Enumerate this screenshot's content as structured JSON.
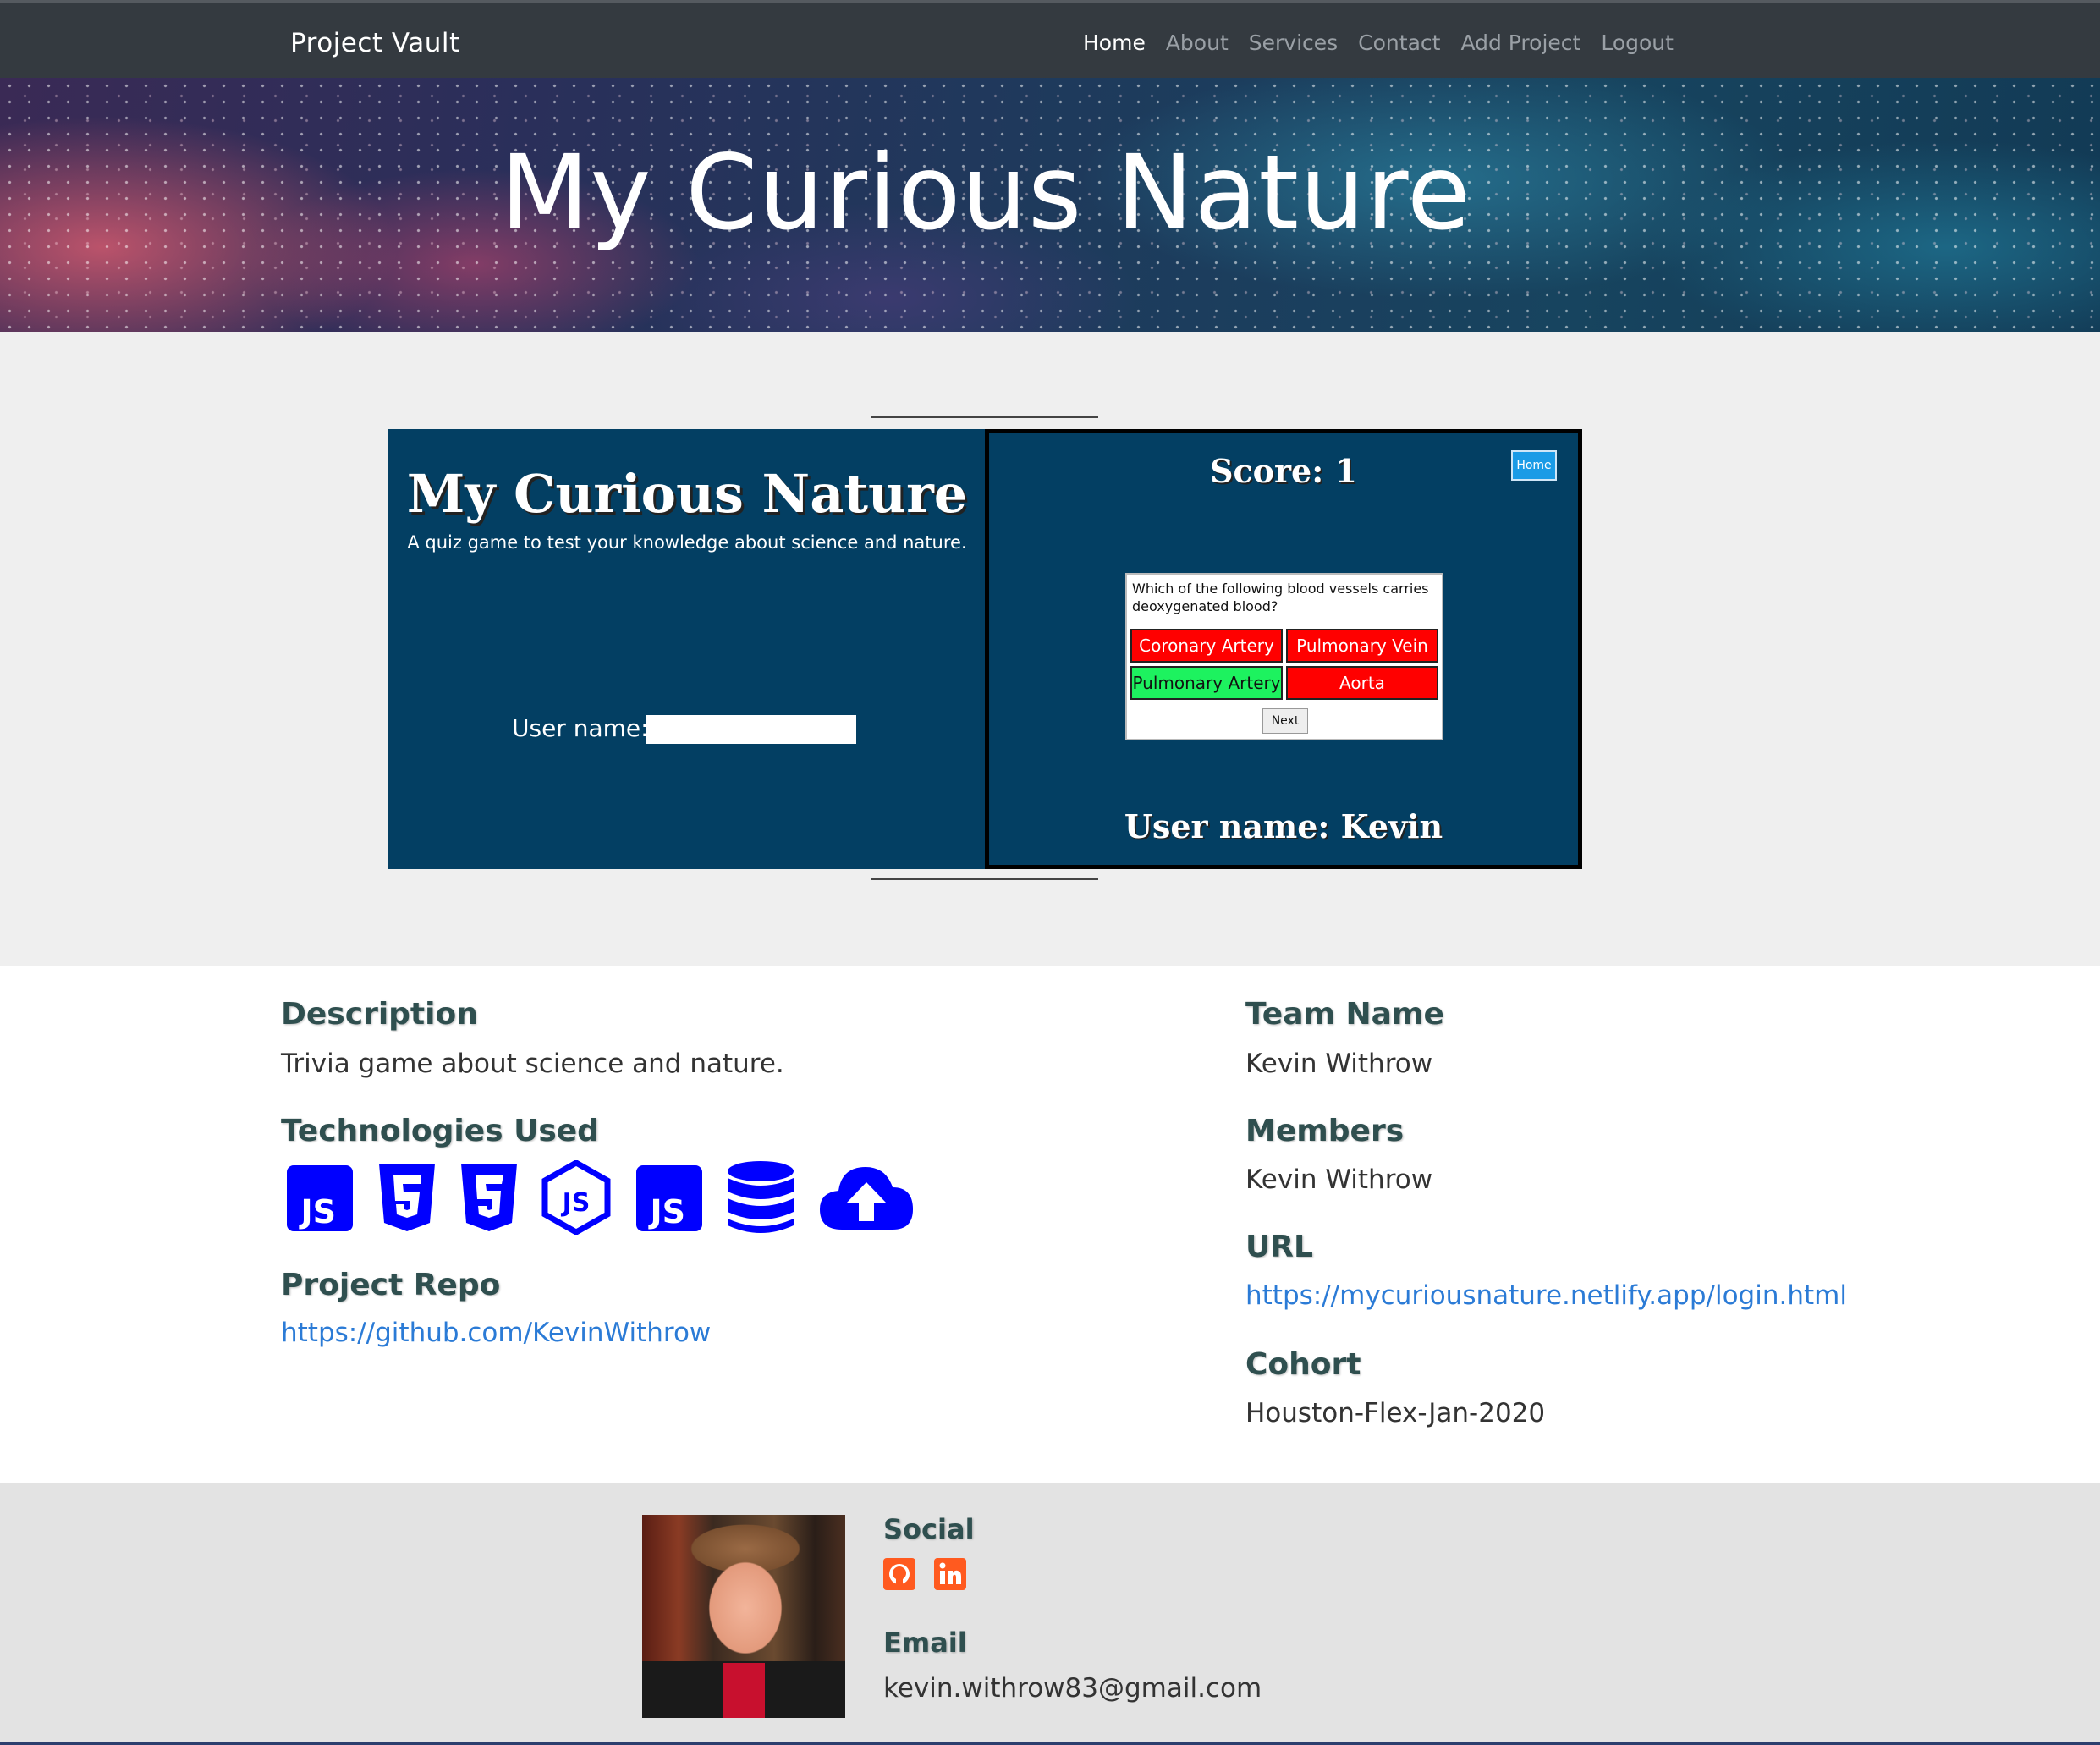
{
  "navbar": {
    "brand": "Project Vault",
    "links": [
      "Home",
      "About",
      "Services",
      "Contact",
      "Add Project",
      "Logout"
    ]
  },
  "hero": {
    "title": "My Curious Nature"
  },
  "preview": {
    "left": {
      "title": "My Curious Nature",
      "subtitle": "A quiz game to test your knowledge about science and nature.",
      "username_label": "User name:"
    },
    "right": {
      "score": "Score: 1",
      "home_button": "Home",
      "question": "Which of the following blood vessels carries deoxygenated blood?",
      "answers": [
        "Coronary Artery",
        "Pulmonary Vein",
        "Pulmonary Artery",
        "Aorta"
      ],
      "next_button": "Next",
      "username": "User name: Kevin"
    }
  },
  "details": {
    "description_heading": "Description",
    "description": "Trivia game about science and nature.",
    "technologies_heading": "Technologies Used",
    "technologies": [
      "js-icon",
      "html5-icon",
      "css3-icon",
      "nodejs-icon",
      "js-icon",
      "database-icon",
      "cloud-upload-icon"
    ],
    "repo_heading": "Project Repo",
    "repo_url": "https://github.com/KevinWithrow",
    "team_heading": "Team Name",
    "team": "Kevin Withrow",
    "members_heading": "Members",
    "members": "Kevin Withrow",
    "url_heading": "URL",
    "url": "https://mycuriousnature.netlify.app/login.html",
    "cohort_heading": "Cohort",
    "cohort": "Houston-Flex-Jan-2020"
  },
  "footer": {
    "social_heading": "Social",
    "social_icons": [
      "github-icon",
      "linkedin-icon"
    ],
    "email_heading": "Email",
    "email": "kevin.withrow83@gmail.com"
  },
  "colors": {
    "navbar": "#343a40",
    "quiz_bg": "#033f63",
    "icon_blue": "#0000ff",
    "social_orange": "#ff5a1f",
    "link": "#2b7bd6"
  }
}
